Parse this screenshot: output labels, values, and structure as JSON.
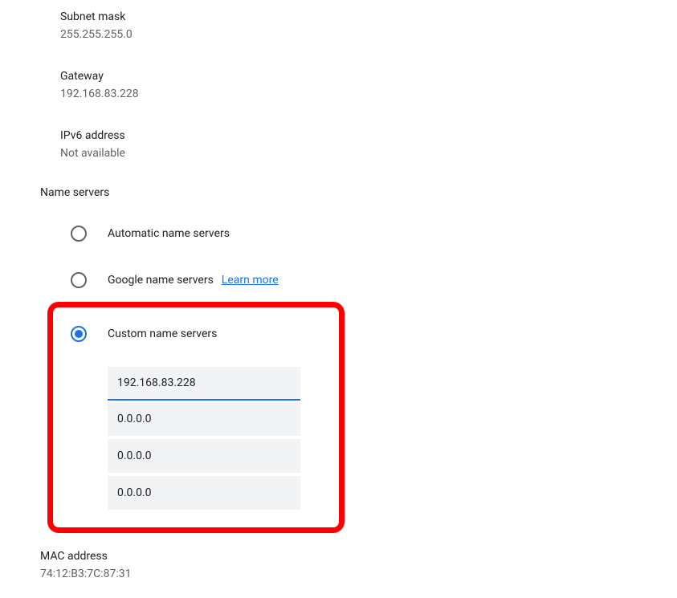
{
  "subnet": {
    "label": "Subnet mask",
    "value": "255.255.255.0"
  },
  "gateway": {
    "label": "Gateway",
    "value": "192.168.83.228"
  },
  "ipv6": {
    "label": "IPv6 address",
    "value": "Not available"
  },
  "nameservers": {
    "header": "Name servers",
    "options": {
      "automatic": "Automatic name servers",
      "google": "Google name servers",
      "google_learn_more": "Learn more",
      "custom": "Custom name servers"
    },
    "custom_values": {
      "0": "192.168.83.228",
      "1": "0.0.0.0",
      "2": "0.0.0.0",
      "3": "0.0.0.0"
    }
  },
  "mac": {
    "label": "MAC address",
    "value": "74:12:B3:7C:87:31"
  }
}
